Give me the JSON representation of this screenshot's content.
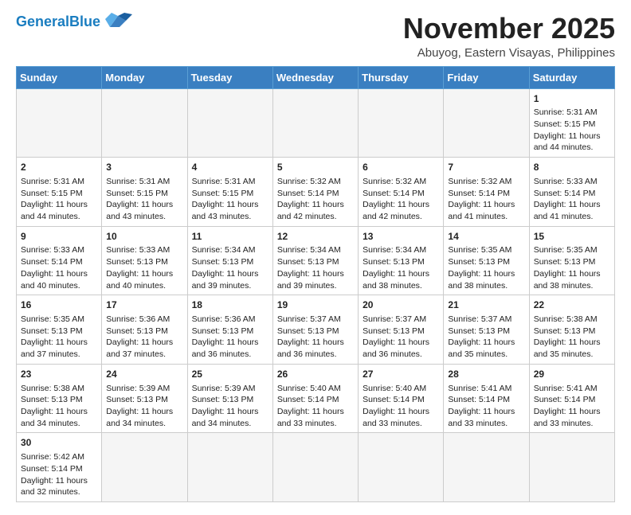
{
  "header": {
    "logo_general": "General",
    "logo_blue": "Blue",
    "month_title": "November 2025",
    "location": "Abuyog, Eastern Visayas, Philippines"
  },
  "weekdays": [
    "Sunday",
    "Monday",
    "Tuesday",
    "Wednesday",
    "Thursday",
    "Friday",
    "Saturday"
  ],
  "weeks": [
    [
      {
        "day": "",
        "empty": true
      },
      {
        "day": "",
        "empty": true
      },
      {
        "day": "",
        "empty": true
      },
      {
        "day": "",
        "empty": true
      },
      {
        "day": "",
        "empty": true
      },
      {
        "day": "",
        "empty": true
      },
      {
        "day": "1",
        "info": "Sunrise: 5:31 AM\nSunset: 5:15 PM\nDaylight: 11 hours\nand 44 minutes."
      }
    ],
    [
      {
        "day": "2",
        "info": "Sunrise: 5:31 AM\nSunset: 5:15 PM\nDaylight: 11 hours\nand 44 minutes."
      },
      {
        "day": "3",
        "info": "Sunrise: 5:31 AM\nSunset: 5:15 PM\nDaylight: 11 hours\nand 43 minutes."
      },
      {
        "day": "4",
        "info": "Sunrise: 5:31 AM\nSunset: 5:15 PM\nDaylight: 11 hours\nand 43 minutes."
      },
      {
        "day": "5",
        "info": "Sunrise: 5:32 AM\nSunset: 5:14 PM\nDaylight: 11 hours\nand 42 minutes."
      },
      {
        "day": "6",
        "info": "Sunrise: 5:32 AM\nSunset: 5:14 PM\nDaylight: 11 hours\nand 42 minutes."
      },
      {
        "day": "7",
        "info": "Sunrise: 5:32 AM\nSunset: 5:14 PM\nDaylight: 11 hours\nand 41 minutes."
      },
      {
        "day": "8",
        "info": "Sunrise: 5:33 AM\nSunset: 5:14 PM\nDaylight: 11 hours\nand 41 minutes."
      }
    ],
    [
      {
        "day": "9",
        "info": "Sunrise: 5:33 AM\nSunset: 5:14 PM\nDaylight: 11 hours\nand 40 minutes."
      },
      {
        "day": "10",
        "info": "Sunrise: 5:33 AM\nSunset: 5:13 PM\nDaylight: 11 hours\nand 40 minutes."
      },
      {
        "day": "11",
        "info": "Sunrise: 5:34 AM\nSunset: 5:13 PM\nDaylight: 11 hours\nand 39 minutes."
      },
      {
        "day": "12",
        "info": "Sunrise: 5:34 AM\nSunset: 5:13 PM\nDaylight: 11 hours\nand 39 minutes."
      },
      {
        "day": "13",
        "info": "Sunrise: 5:34 AM\nSunset: 5:13 PM\nDaylight: 11 hours\nand 38 minutes."
      },
      {
        "day": "14",
        "info": "Sunrise: 5:35 AM\nSunset: 5:13 PM\nDaylight: 11 hours\nand 38 minutes."
      },
      {
        "day": "15",
        "info": "Sunrise: 5:35 AM\nSunset: 5:13 PM\nDaylight: 11 hours\nand 38 minutes."
      }
    ],
    [
      {
        "day": "16",
        "info": "Sunrise: 5:35 AM\nSunset: 5:13 PM\nDaylight: 11 hours\nand 37 minutes."
      },
      {
        "day": "17",
        "info": "Sunrise: 5:36 AM\nSunset: 5:13 PM\nDaylight: 11 hours\nand 37 minutes."
      },
      {
        "day": "18",
        "info": "Sunrise: 5:36 AM\nSunset: 5:13 PM\nDaylight: 11 hours\nand 36 minutes."
      },
      {
        "day": "19",
        "info": "Sunrise: 5:37 AM\nSunset: 5:13 PM\nDaylight: 11 hours\nand 36 minutes."
      },
      {
        "day": "20",
        "info": "Sunrise: 5:37 AM\nSunset: 5:13 PM\nDaylight: 11 hours\nand 36 minutes."
      },
      {
        "day": "21",
        "info": "Sunrise: 5:37 AM\nSunset: 5:13 PM\nDaylight: 11 hours\nand 35 minutes."
      },
      {
        "day": "22",
        "info": "Sunrise: 5:38 AM\nSunset: 5:13 PM\nDaylight: 11 hours\nand 35 minutes."
      }
    ],
    [
      {
        "day": "23",
        "info": "Sunrise: 5:38 AM\nSunset: 5:13 PM\nDaylight: 11 hours\nand 34 minutes."
      },
      {
        "day": "24",
        "info": "Sunrise: 5:39 AM\nSunset: 5:13 PM\nDaylight: 11 hours\nand 34 minutes."
      },
      {
        "day": "25",
        "info": "Sunrise: 5:39 AM\nSunset: 5:13 PM\nDaylight: 11 hours\nand 34 minutes."
      },
      {
        "day": "26",
        "info": "Sunrise: 5:40 AM\nSunset: 5:14 PM\nDaylight: 11 hours\nand 33 minutes."
      },
      {
        "day": "27",
        "info": "Sunrise: 5:40 AM\nSunset: 5:14 PM\nDaylight: 11 hours\nand 33 minutes."
      },
      {
        "day": "28",
        "info": "Sunrise: 5:41 AM\nSunset: 5:14 PM\nDaylight: 11 hours\nand 33 minutes."
      },
      {
        "day": "29",
        "info": "Sunrise: 5:41 AM\nSunset: 5:14 PM\nDaylight: 11 hours\nand 33 minutes."
      }
    ],
    [
      {
        "day": "30",
        "info": "Sunrise: 5:42 AM\nSunset: 5:14 PM\nDaylight: 11 hours\nand 32 minutes."
      },
      {
        "day": "",
        "empty": true
      },
      {
        "day": "",
        "empty": true
      },
      {
        "day": "",
        "empty": true
      },
      {
        "day": "",
        "empty": true
      },
      {
        "day": "",
        "empty": true
      },
      {
        "day": "",
        "empty": true
      }
    ]
  ]
}
